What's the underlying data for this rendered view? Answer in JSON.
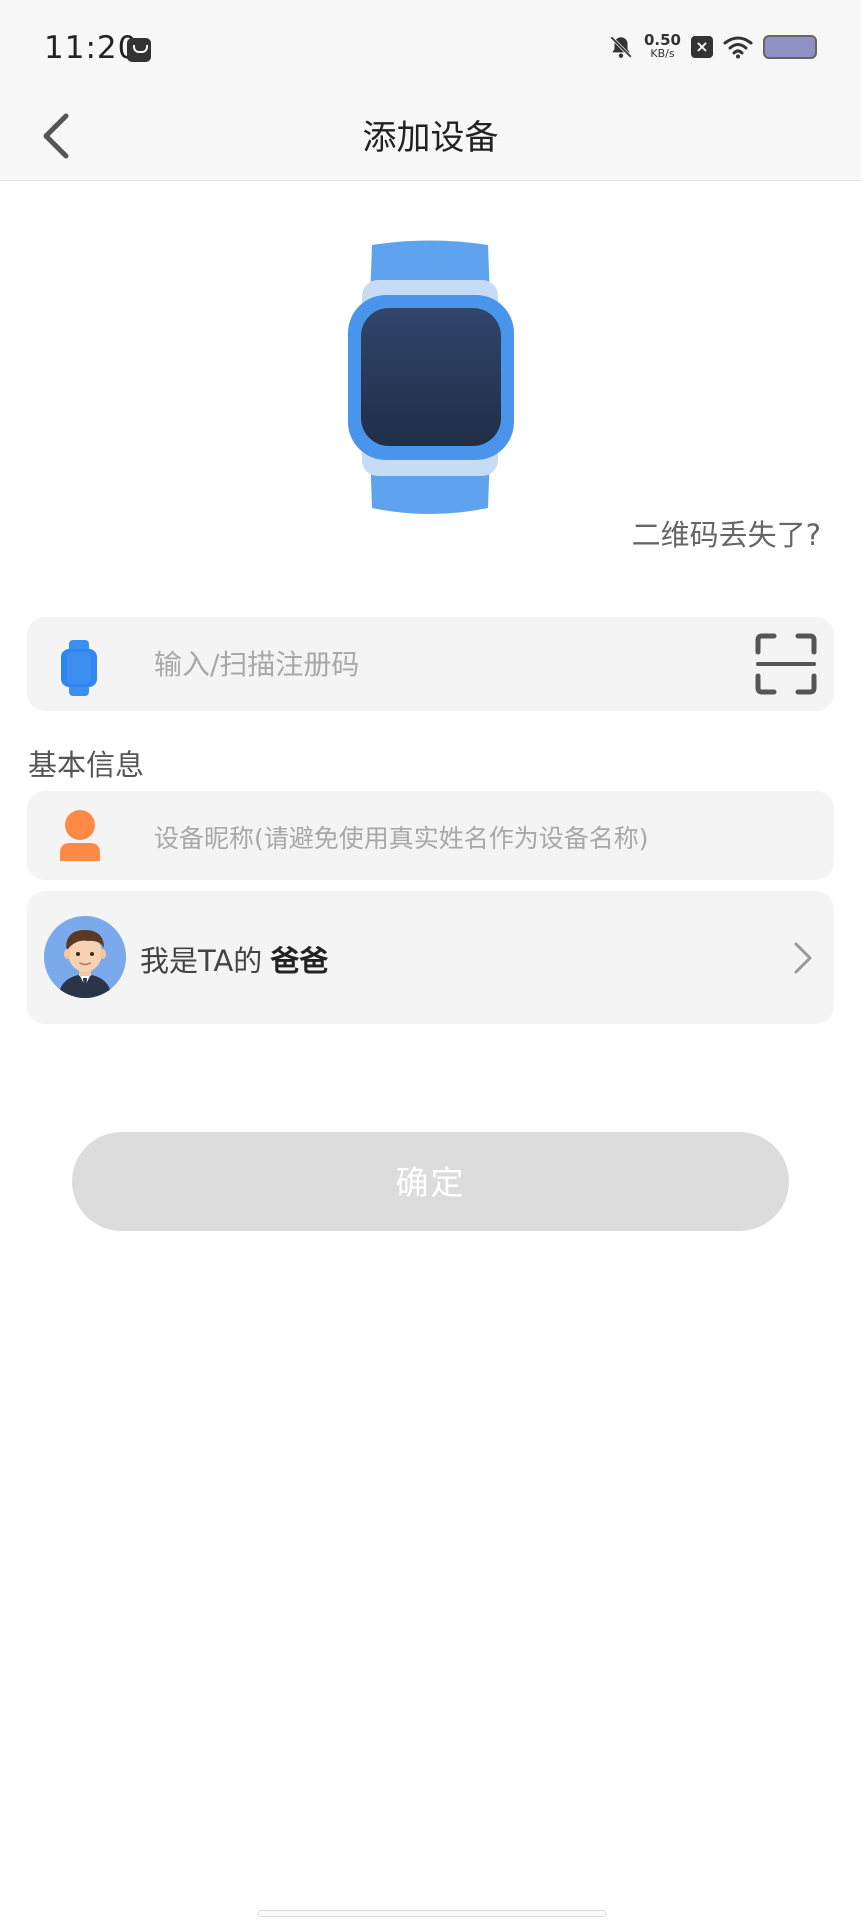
{
  "status_bar": {
    "time": "11:20",
    "speed_value": "0.50",
    "speed_unit": "KB/s"
  },
  "header": {
    "title": "添加设备",
    "back_icon": "chevron-left-icon"
  },
  "hero": {
    "image": "smart-watch-illustration",
    "lost_qr_link": "二维码丢失了?"
  },
  "registration": {
    "placeholder": "输入/扫描注册码",
    "icon": "watch-icon",
    "scan_icon": "scan-icon"
  },
  "basic_info": {
    "label": "基本信息",
    "nickname_placeholder": "设备昵称(请避免使用真实姓名作为设备名称)",
    "relation_prefix": "我是TA的",
    "relation_value": "爸爸"
  },
  "actions": {
    "confirm_label": "确定"
  },
  "colors": {
    "accent_blue": "#3c8ff0",
    "orange": "#ff8a45",
    "button_disabled": "#dcdcdc"
  }
}
